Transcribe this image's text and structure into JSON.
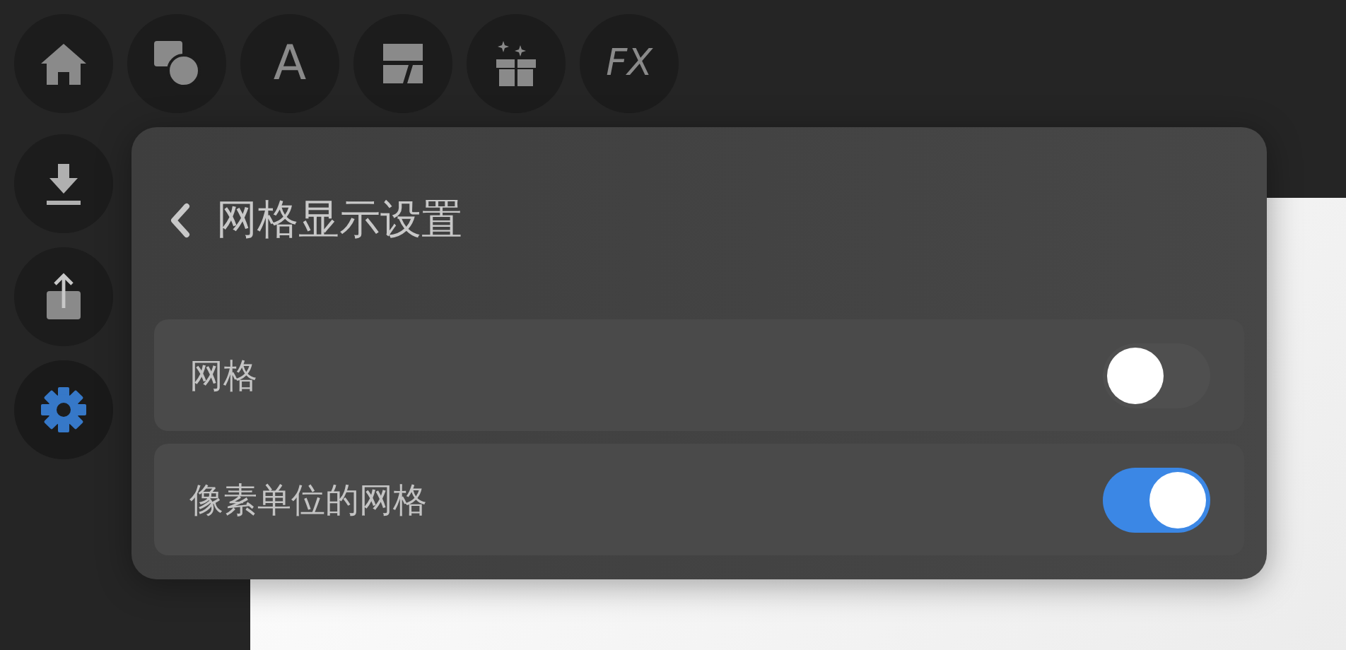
{
  "toolbar": [
    {
      "kind": "home",
      "selected": false
    },
    {
      "kind": "shapes",
      "selected": false
    },
    {
      "kind": "text",
      "label": "A",
      "selected": false
    },
    {
      "kind": "layout",
      "selected": false
    },
    {
      "kind": "gift",
      "selected": false
    },
    {
      "kind": "fx",
      "label": "FX",
      "selected": false
    }
  ],
  "sidebar": [
    {
      "kind": "download",
      "selected": false
    },
    {
      "kind": "share",
      "selected": false
    },
    {
      "kind": "settings",
      "selected": true
    }
  ],
  "panel": {
    "title": "网格显示设置",
    "settings": [
      {
        "label": "网格",
        "on": false
      },
      {
        "label": "像素单位的网格",
        "on": true
      }
    ]
  }
}
